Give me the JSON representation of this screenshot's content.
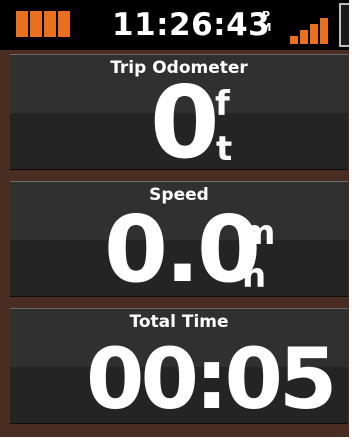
{
  "status_bar": {
    "time": "11:26:43",
    "ampm_top": "P",
    "ampm_bottom": "M",
    "battery_icon": "battery-full-icon",
    "signal_icon": "gps-signal-icon"
  },
  "fields": [
    {
      "label": "Trip Odometer",
      "value": "0",
      "unit_top": "f",
      "unit_bottom": "t"
    },
    {
      "label": "Speed",
      "value": "0.0",
      "unit_top": "m",
      "unit_bottom": "h"
    },
    {
      "label": "Total Time",
      "value": "00:05"
    }
  ],
  "colors": {
    "accent": "#e8701e",
    "background": "#4a2d22",
    "field_bg": "#242424",
    "field_band": "#303030",
    "status_bg": "#000000"
  }
}
